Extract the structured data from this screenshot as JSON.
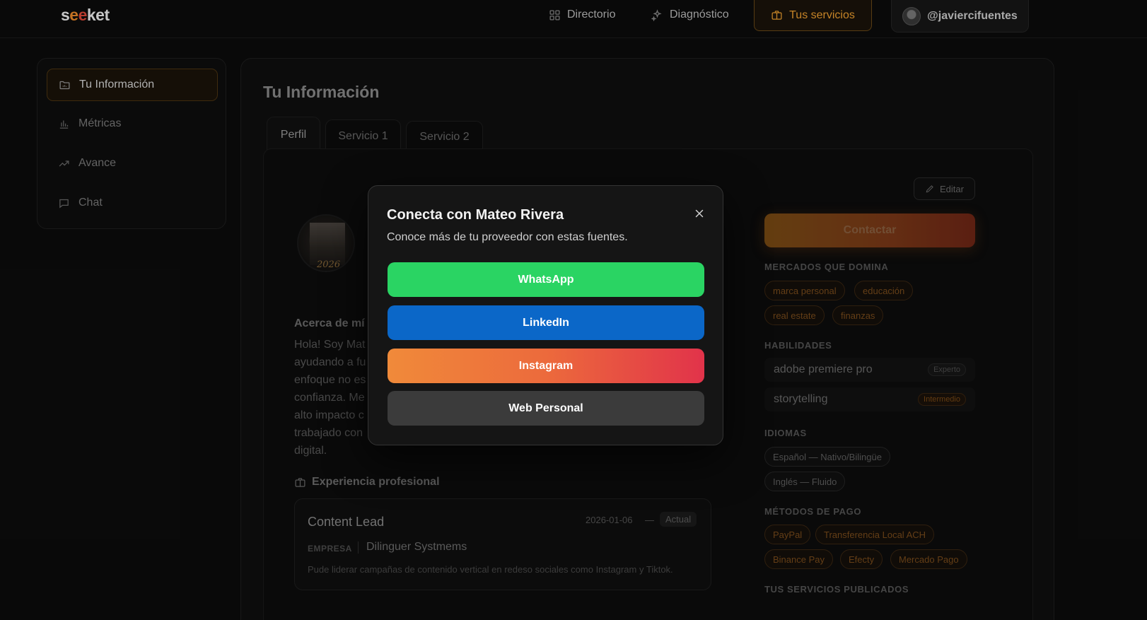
{
  "brand": {
    "logo_part1": "s",
    "logo_part2": "e",
    "logo_part3": "e",
    "logo_rest": "ket"
  },
  "nav": {
    "directorio": "Directorio",
    "diagnostico": "Diagnóstico",
    "servicios": "Tus servicios",
    "user": "@javiercifuentes"
  },
  "sidebar": {
    "items": [
      {
        "label": "Tu Información",
        "icon": "folder-icon",
        "active": true
      },
      {
        "label": "Métricas",
        "icon": "bar-chart-icon"
      },
      {
        "label": "Avance",
        "icon": "trending-up-icon"
      },
      {
        "label": "Chat",
        "icon": "chat-icon"
      }
    ]
  },
  "main": {
    "title": "Tu Información",
    "tabs": [
      "Perfil",
      "Servicio 1",
      "Servicio 2"
    ],
    "avatar_year": "2026",
    "about_title": "Acerca de mí",
    "about_text": "Hola! Soy Mat\nayudando a fu\nenfoque no es\nconfianza. Me\nalto impacto c\ntrabajado con\ndigital.",
    "experience_title": "Experiencia profesional",
    "experience": {
      "role": "Content Lead",
      "date": "2026-01-06",
      "dash": "—",
      "status": "Actual",
      "company_label": "EMPRESA",
      "company": "Dilinguer Systmems",
      "description": "Pude liderar campañas de contenido vertical en redeso sociales como Instagram y Tiktok."
    },
    "edit_label": "Editar",
    "contact_label": "Contactar",
    "markets_label": "MERCADOS QUE DOMINA",
    "markets": [
      "marca personal",
      "educación",
      "real estate",
      "finanzas"
    ],
    "skills_label": "HABILIDADES",
    "skills": [
      {
        "name": "adobe premiere pro",
        "level": "Experto"
      },
      {
        "name": "storytelling",
        "level": "Intermedio"
      }
    ],
    "languages_label": "IDIOMAS",
    "languages": [
      "Español — Nativo/Bilingüe",
      "Inglés — Fluido"
    ],
    "payments_label": "MÉTODOS DE PAGO",
    "payments": [
      "PayPal",
      "Transferencia Local ACH",
      "Binance Pay",
      "Efecty",
      "Mercado Pago"
    ],
    "published_label": "TUS SERVICIOS PUBLICADOS"
  },
  "modal": {
    "title": "Conecta con Mateo Rivera",
    "subtitle": "Conoce más de tu proveedor con estas fuentes.",
    "buttons": {
      "whatsapp": "WhatsApp",
      "linkedin": "LinkedIn",
      "instagram": "Instagram",
      "web": "Web Personal"
    }
  },
  "colors": {
    "accent": "#f0a030",
    "whatsapp": "#2ad463",
    "linkedin": "#0b67c8",
    "instagram_start": "#f08a3a",
    "instagram_end": "#e1334a",
    "web": "#3b3b3b"
  }
}
